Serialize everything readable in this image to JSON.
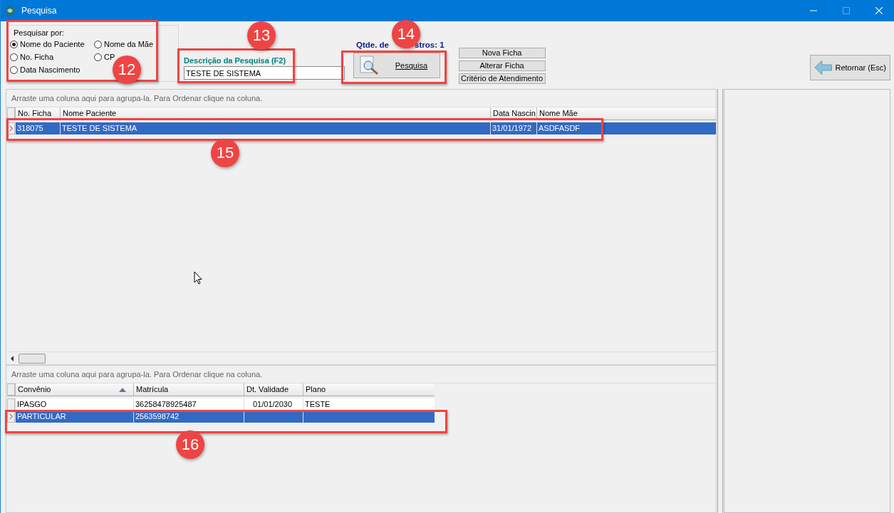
{
  "window": {
    "title": "Pesquisa"
  },
  "search_by": {
    "legend": "Pesquisar por:",
    "options": [
      {
        "label": "Nome do Paciente",
        "selected": true
      },
      {
        "label": "Nome da Mãe",
        "selected": false
      },
      {
        "label": "No. Ficha",
        "selected": false
      },
      {
        "label": "CP",
        "selected": false
      },
      {
        "label": "Data Nascimento",
        "selected": false
      }
    ]
  },
  "description": {
    "label": "Descrição da Pesquisa (F2)",
    "value": "TESTE DE SISTEMA"
  },
  "count_parts": [
    "Qtde. de",
    "stros: 1"
  ],
  "search_button": "Pesquisa",
  "side_buttons": [
    "Nova Ficha",
    "Alterar Ficha",
    "Critério de Atendimento"
  ],
  "return_button": "Retornar (Esc)",
  "patients": {
    "group_hint": "Arraste uma coluna aqui para agrupa-la. Para Ordenar clique na coluna.",
    "columns": [
      "No. Ficha",
      "Nome Paciente",
      "Data Nascin",
      "Nome Mãe"
    ],
    "rows": [
      {
        "cells": [
          "318075",
          "TESTE DE SISTEMA",
          "31/01/1972",
          "ASDFASDF"
        ],
        "selected": true
      }
    ]
  },
  "plans": {
    "group_hint": "Arraste uma coluna aqui para agrupa-la. Para Ordenar clique na coluna.",
    "columns": [
      "Convênio",
      "Matrícula",
      "Dt. Validade",
      "Plano"
    ],
    "rows": [
      {
        "cells": [
          "IPASGO",
          "36258478925487",
          "01/01/2030",
          "TESTE"
        ],
        "selected": false
      },
      {
        "cells": [
          "PARTICULAR",
          "2563598742",
          "",
          ""
        ],
        "selected": true
      }
    ]
  },
  "annotations": [
    {
      "label": "12"
    },
    {
      "label": "13"
    },
    {
      "label": "14"
    },
    {
      "label": "15"
    },
    {
      "label": "16"
    }
  ]
}
